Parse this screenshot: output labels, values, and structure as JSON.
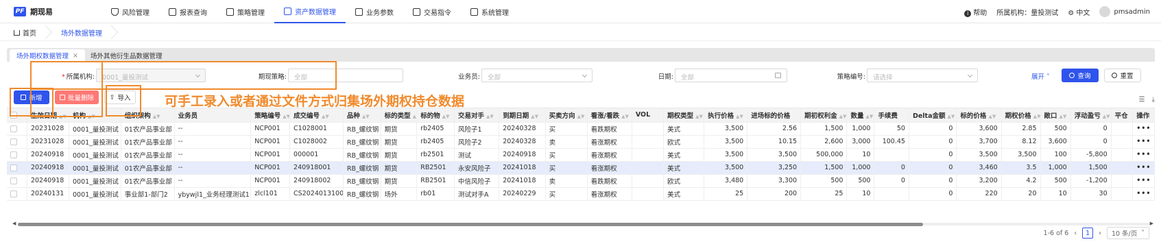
{
  "app": {
    "name": "期现易",
    "logo_icon": "logo-icon"
  },
  "nav": [
    {
      "label": "风险管理",
      "icon": "shield-icon",
      "active": false
    },
    {
      "label": "报表查询",
      "icon": "grid-icon",
      "active": false
    },
    {
      "label": "策略管理",
      "icon": "document-icon",
      "active": false
    },
    {
      "label": "资产数据管理",
      "icon": "document-icon",
      "active": true
    },
    {
      "label": "业务参数",
      "icon": "database-icon",
      "active": false
    },
    {
      "label": "交易指令",
      "icon": "transfer-icon",
      "active": false
    },
    {
      "label": "系统管理",
      "icon": "settings-icon",
      "active": false
    }
  ],
  "topright": {
    "help": "帮助",
    "org": "所属机构：量投测试",
    "lang": "中文",
    "user": "pmsadmin"
  },
  "breadcrumb": {
    "home": "首页",
    "current": "场外数据管理"
  },
  "tabs": [
    {
      "label": "场外期权数据管理",
      "active": true
    },
    {
      "label": "场外其他衍生品数据管理",
      "active": false
    }
  ],
  "filters": {
    "org_label": "所属机构:",
    "org_value": "0001_量投测试",
    "strategy_label": "期现策略:",
    "strategy_placeholder": "全部",
    "staff_label": "业务员:",
    "staff_placeholder": "全部",
    "date_label": "日期:",
    "date_placeholder": "全部",
    "code_label": "策略编号:",
    "code_placeholder": "请选择",
    "expand": "展开",
    "query": "查询",
    "reset": "重置"
  },
  "toolbar": {
    "add": "新增",
    "batch_delete": "批量删除",
    "import": "导入"
  },
  "annotation": "可手工录入或者通过文件方式归集场外期权持仓数据",
  "table": {
    "headers": [
      "生效日期",
      "机构",
      "组织架构",
      "业务员",
      "策略编号",
      "成交编号",
      "品种",
      "标的类型",
      "标的物",
      "交易对手",
      "到期日期",
      "买卖方向",
      "看涨/看跌",
      "VOL",
      "期权类型",
      "执行价格",
      "进场标的价格",
      "期初权利金",
      "数量",
      "手续费",
      "Delta金额",
      "标的价格",
      "期权价格",
      "敞口",
      "浮动盈亏",
      "平仓",
      "操作"
    ],
    "rows": [
      [
        "20231028",
        "0001_量投测试",
        "01农产品事业部",
        "--",
        "NCP001",
        "C1028001",
        "RB_螺纹钢",
        "期货",
        "rb2405",
        "风险子1",
        "20240328",
        "买",
        "看跌期权",
        "",
        "美式",
        "3,500",
        "2.56",
        "1,500",
        "1,000",
        "50",
        "0",
        "3,600",
        "2.85",
        "500",
        "0",
        "",
        ""
      ],
      [
        "20231028",
        "0001_量投测试",
        "01农产品事业部",
        "--",
        "NCP001",
        "C1028002",
        "RB_螺纹钢",
        "期货",
        "rb2405",
        "风险子2",
        "20240328",
        "卖",
        "看涨期权",
        "",
        "欧式",
        "3,500",
        "10.15",
        "2,600",
        "3,000",
        "100.45",
        "0",
        "3,700",
        "8.12",
        "3,600",
        "0",
        "",
        ""
      ],
      [
        "20240918",
        "0001_量投测试",
        "01农产品事业部",
        "--",
        "NCP001",
        "000001",
        "RB_螺纹钢",
        "期货",
        "rb2501",
        "测试",
        "20240918",
        "买",
        "看涨期权",
        "",
        "美式",
        "3,500",
        "3,500",
        "500,000",
        "10",
        "",
        "0",
        "3,500",
        "3,500",
        "100",
        "-5,800",
        "",
        ""
      ],
      [
        "20240918",
        "0001_量投测试",
        "01农产品事业部",
        "--",
        "NCP001",
        "240918001",
        "RB_螺纹钢",
        "期货",
        "RB2501",
        "永安风险子",
        "20241018",
        "买",
        "看涨期权",
        "",
        "美式",
        "3,500",
        "3,250",
        "1,500",
        "1,000",
        "0",
        "0",
        "3,460",
        "3.5",
        "1,000",
        "1,500",
        "",
        ""
      ],
      [
        "20240918",
        "0001_量投测试",
        "01农产品事业部",
        "--",
        "NCP001",
        "240918002",
        "RB_螺纹钢",
        "期货",
        "RB2501",
        "中信风险子",
        "20241018",
        "卖",
        "看跌期权",
        "",
        "欧式",
        "3,480",
        "3,300",
        "500",
        "500",
        "0",
        "0",
        "3,200",
        "4.2",
        "500",
        "-1,200",
        "",
        ""
      ],
      [
        "20240131",
        "0001_量投测试",
        "事业部1-部门2",
        "ybywjl1_业务经理测试1",
        "zlcl101",
        "CS20240131001",
        "RB_螺纹钢",
        "场外",
        "rb01",
        "测试对手A",
        "20240229",
        "买",
        "看涨期权",
        "",
        "美式",
        "25",
        "200",
        "25",
        "10",
        "",
        "0",
        "220",
        "20",
        "10",
        "30",
        "",
        ""
      ]
    ]
  },
  "pager": {
    "total": "1-6 of 6",
    "current": "1",
    "size": "10 条/页"
  }
}
